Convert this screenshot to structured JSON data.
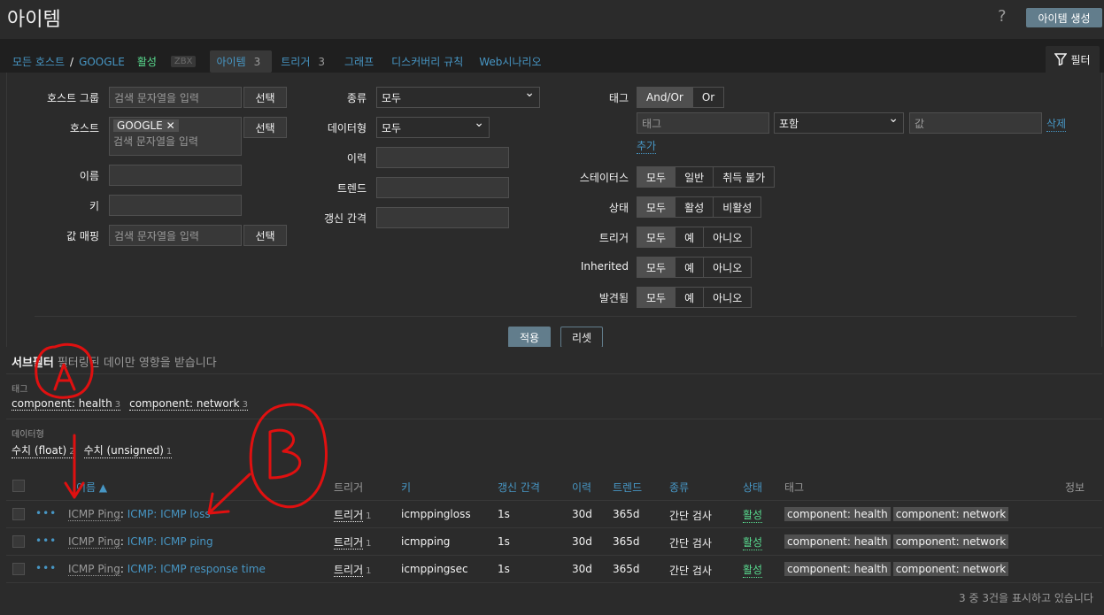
{
  "header": {
    "title": "아이템",
    "help": "?",
    "create_button": "아이템 생성"
  },
  "nav": {
    "all_hosts": "모든 호스트",
    "separator": "/",
    "host": "GOOGLE",
    "status": "활성",
    "zbx": "ZBX",
    "tabs": [
      {
        "label": "아이템",
        "count": "3"
      },
      {
        "label": "트리거",
        "count": "3"
      },
      {
        "label": "그래프",
        "count": ""
      },
      {
        "label": "디스커버리 규칙",
        "count": ""
      },
      {
        "label": "Web시나리오",
        "count": ""
      }
    ],
    "filter_tab": "필터"
  },
  "filter": {
    "host_group": {
      "label": "호스트 그룹",
      "placeholder": "검색 문자열을 입력",
      "select": "선택"
    },
    "host": {
      "label": "호스트",
      "chip": "GOOGLE",
      "placeholder": "검색 문자열을 입력",
      "select": "선택"
    },
    "name": {
      "label": "이름",
      "value": ""
    },
    "key": {
      "label": "키",
      "value": ""
    },
    "value_map": {
      "label": "값 매핑",
      "placeholder": "검색 문자열을 입력",
      "select": "선택"
    },
    "type": {
      "label": "종류",
      "value": "모두"
    },
    "data_type": {
      "label": "데이터형",
      "value": "모두"
    },
    "history": {
      "label": "이력",
      "value": ""
    },
    "trends": {
      "label": "트렌드",
      "value": ""
    },
    "interval": {
      "label": "갱신 간격",
      "value": ""
    },
    "tags": {
      "label": "태그",
      "opt1": "And/Or",
      "opt2": "Or",
      "tag_placeholder": "태그",
      "operator": "포함",
      "value_placeholder": "값",
      "remove": "삭제",
      "add": "추가"
    },
    "state": {
      "label": "스테이터스",
      "options": [
        "모두",
        "일반",
        "취득 불가"
      ]
    },
    "status": {
      "label": "상태",
      "options": [
        "모두",
        "활성",
        "비활성"
      ]
    },
    "triggers": {
      "label": "트리거",
      "options": [
        "모두",
        "예",
        "아니오"
      ]
    },
    "inherited": {
      "label": "Inherited",
      "options": [
        "모두",
        "예",
        "아니오"
      ]
    },
    "discovered": {
      "label": "발견됨",
      "options": [
        "모두",
        "예",
        "아니오"
      ]
    },
    "apply": "적용",
    "reset": "리셋"
  },
  "subfilter": {
    "title": "서브필터",
    "hint": "필터링된 데이만 영향을 받습니다",
    "tags_caption": "태그",
    "tags": [
      {
        "label": "component: health",
        "count": "3"
      },
      {
        "label": "component: network",
        "count": "3"
      }
    ],
    "datatype_caption": "데이터형",
    "datatypes": [
      {
        "label": "수치 (float)",
        "count": "2"
      },
      {
        "label": "수치 (unsigned)",
        "count": "1"
      }
    ]
  },
  "table": {
    "headers": {
      "name": "이름 ▲",
      "triggers": "트리거",
      "key": "키",
      "interval": "갱신 간격",
      "history": "이력",
      "trends": "트렌드",
      "type": "종류",
      "status": "상태",
      "tags": "태그",
      "info": "정보"
    },
    "rows": [
      {
        "prefix": "ICMP Ping",
        "name": "ICMP: ICMP loss",
        "trigger": "트리거",
        "trigger_count": "1",
        "key": "icmppingloss",
        "interval": "1s",
        "history": "30d",
        "trends": "365d",
        "type": "간단 검사",
        "status": "활성",
        "tag1": "component: health",
        "tag2": "component: network"
      },
      {
        "prefix": "ICMP Ping",
        "name": "ICMP: ICMP ping",
        "trigger": "트리거",
        "trigger_count": "1",
        "key": "icmpping",
        "interval": "1s",
        "history": "30d",
        "trends": "365d",
        "type": "간단 검사",
        "status": "활성",
        "tag1": "component: health",
        "tag2": "component: network"
      },
      {
        "prefix": "ICMP Ping",
        "name": "ICMP: ICMP response time",
        "trigger": "트리거",
        "trigger_count": "1",
        "key": "icmppingsec",
        "interval": "1s",
        "history": "30d",
        "trends": "365d",
        "type": "간단 검사",
        "status": "활성",
        "tag1": "component: health",
        "tag2": "component: network"
      }
    ],
    "footer": "3 중 3건을 표시하고 있습니다"
  },
  "colors": {
    "accent": "#4796c4",
    "green": "#59db8f",
    "button": "#627d8c",
    "annotation": "#e01010"
  }
}
